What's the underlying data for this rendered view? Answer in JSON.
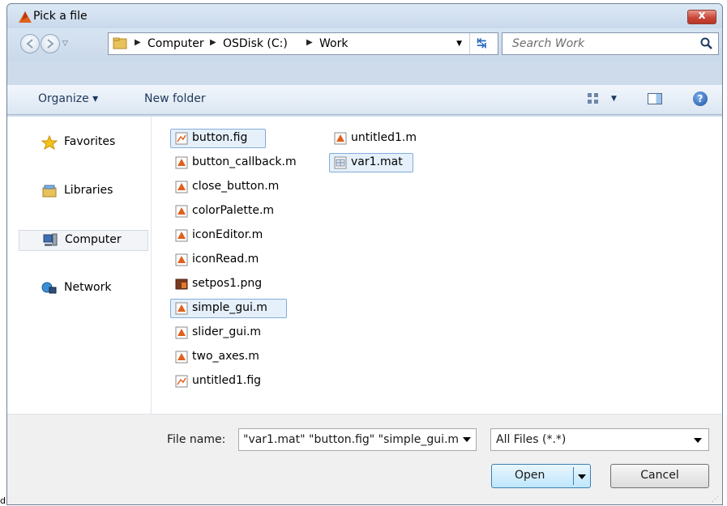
{
  "window": {
    "title": "Pick a file",
    "close_label": "x"
  },
  "address": {
    "crumbs": [
      "Computer",
      "OSDisk (C:)",
      "Work"
    ],
    "search_placeholder": "Search Work"
  },
  "toolbar": {
    "organize": "Organize ▾",
    "new_folder": "New folder"
  },
  "nav": [
    {
      "label": "Favorites",
      "icon": "star-icon"
    },
    {
      "label": "Libraries",
      "icon": "libraries-icon"
    },
    {
      "label": "Computer",
      "icon": "computer-icon",
      "selected": true
    },
    {
      "label": "Network",
      "icon": "network-icon"
    }
  ],
  "files": [
    {
      "name": "button.fig",
      "type": "fig",
      "selected": true
    },
    {
      "name": "button_callback.m",
      "type": "m"
    },
    {
      "name": "close_button.m",
      "type": "m"
    },
    {
      "name": "colorPalette.m",
      "type": "m"
    },
    {
      "name": "iconEditor.m",
      "type": "m"
    },
    {
      "name": "iconRead.m",
      "type": "m"
    },
    {
      "name": "setpos1.png",
      "type": "png"
    },
    {
      "name": "simple_gui.m",
      "type": "m",
      "selected": true
    },
    {
      "name": "slider_gui.m",
      "type": "m"
    },
    {
      "name": "two_axes.m",
      "type": "m"
    },
    {
      "name": "untitled1.fig",
      "type": "fig"
    },
    {
      "name": "untitled1.m",
      "type": "m"
    },
    {
      "name": "var1.mat",
      "type": "mat",
      "selected": true
    }
  ],
  "bottom": {
    "file_name_label": "File name:",
    "file_name_value": "\"var1.mat\" \"button.fig\" \"simple_gui.m\"",
    "filter_value": "All Files (*.*)",
    "open_label": "Open",
    "cancel_label": "Cancel"
  },
  "page_mark": "d"
}
